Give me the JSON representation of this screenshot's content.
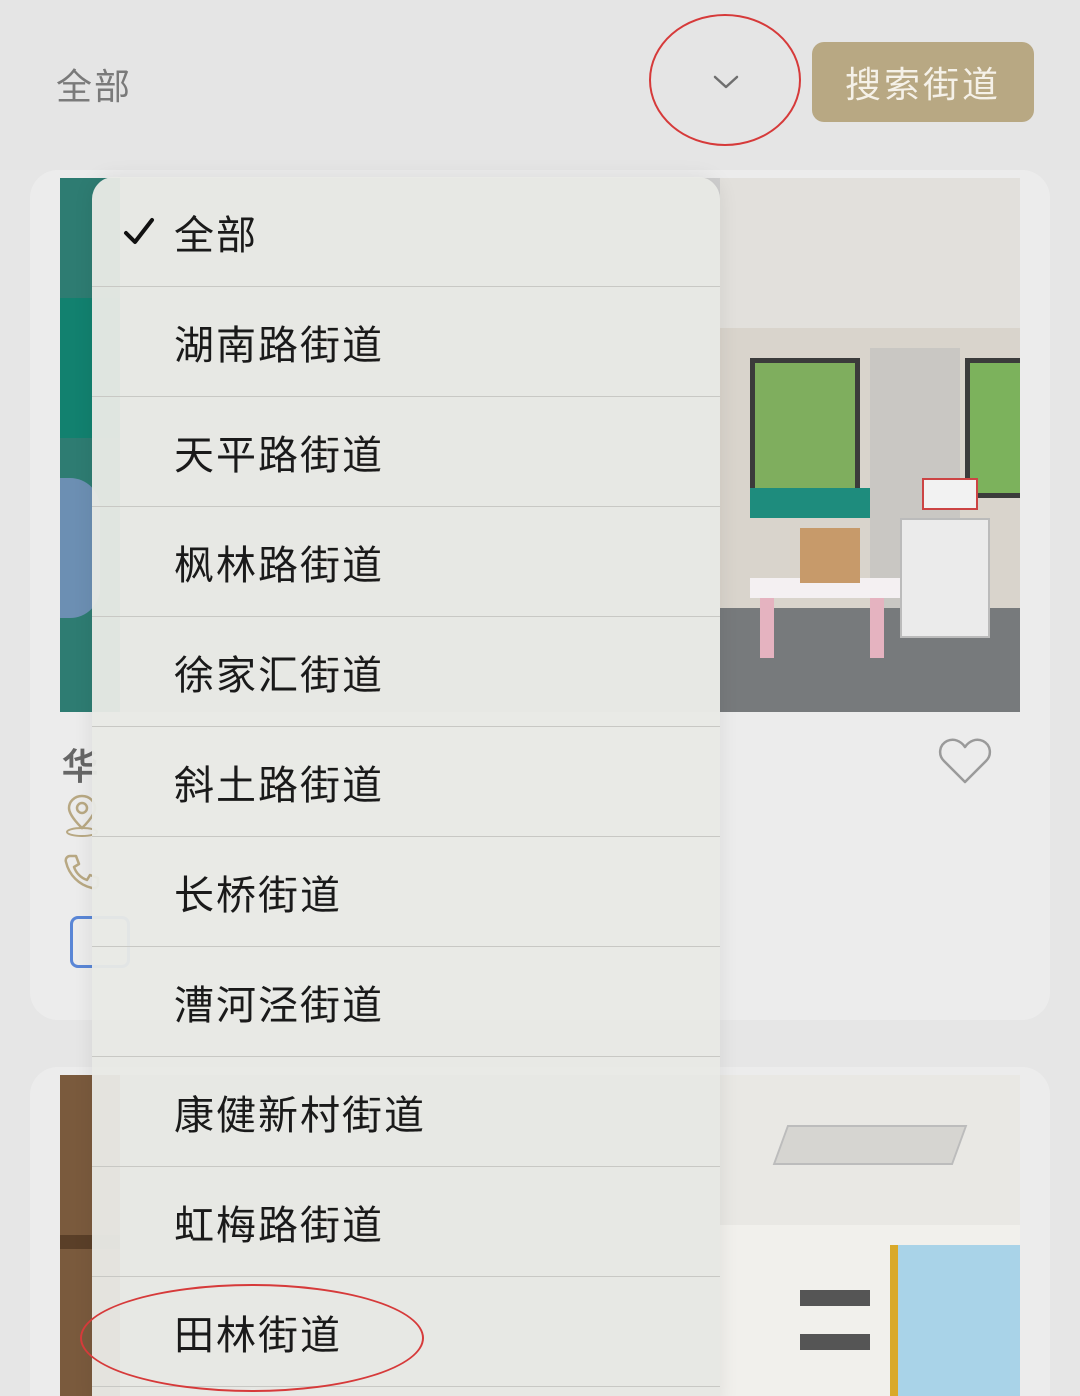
{
  "filter": {
    "current_value": "全部",
    "search_button_label": "搜索街道"
  },
  "card1": {
    "title_partial": "华"
  },
  "dropdown": {
    "items": [
      {
        "label": "全部",
        "selected": true
      },
      {
        "label": "湖南路街道",
        "selected": false
      },
      {
        "label": "天平路街道",
        "selected": false
      },
      {
        "label": "枫林路街道",
        "selected": false
      },
      {
        "label": "徐家汇街道",
        "selected": false
      },
      {
        "label": "斜土路街道",
        "selected": false
      },
      {
        "label": "长桥街道",
        "selected": false
      },
      {
        "label": "漕河泾街道",
        "selected": false
      },
      {
        "label": "康健新村街道",
        "selected": false
      },
      {
        "label": "虹梅路街道",
        "selected": false
      },
      {
        "label": "田林街道",
        "selected": false
      }
    ]
  },
  "icons": {
    "chevron": "chevron-down-icon",
    "check": "checkmark-icon",
    "pin": "location-pin-icon",
    "phone": "phone-icon",
    "heart": "heart-icon"
  },
  "colors": {
    "search_button": "#b8a883",
    "annotation": "#d63a3a",
    "tag_border": "#5a86d6"
  }
}
